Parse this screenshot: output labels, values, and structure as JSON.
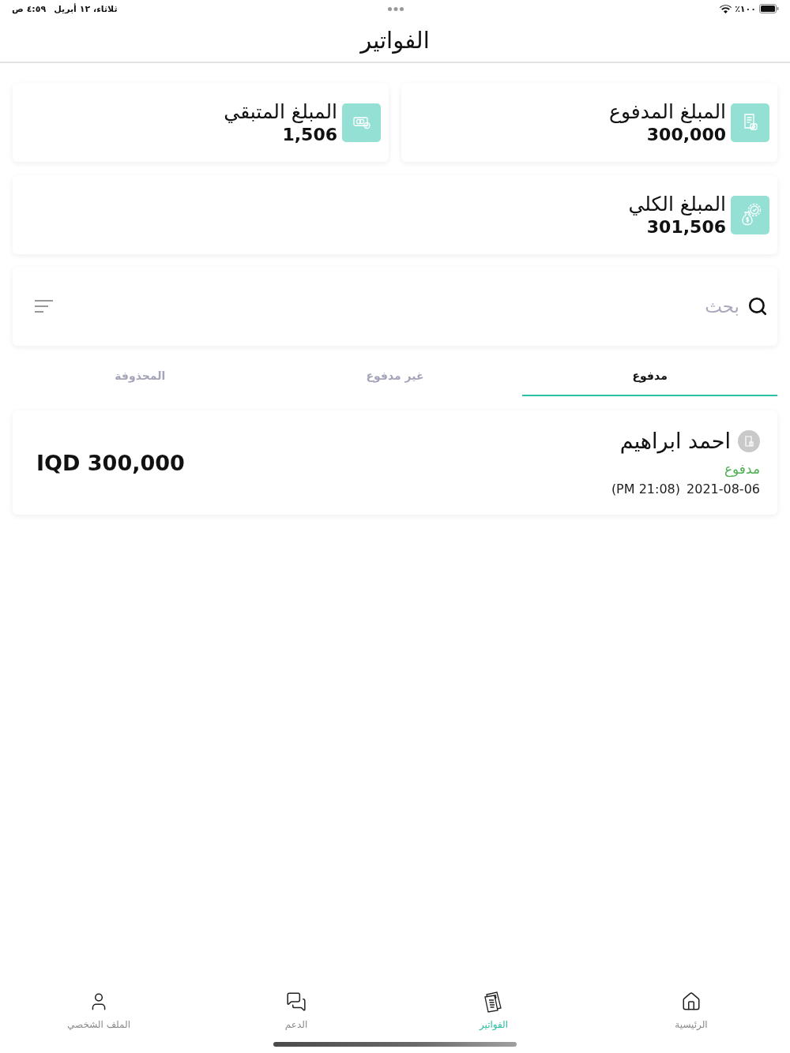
{
  "status_bar": {
    "time": "٤:٥٩ ص",
    "date": "ثلاثاء، ١٢ أبريل",
    "battery": "٪١٠٠"
  },
  "header": {
    "title": "الفواتير"
  },
  "summary_cards": [
    {
      "kind": "paid",
      "label": "المبلغ المدفوع",
      "value": "300,000"
    },
    {
      "kind": "remaining",
      "label": "المبلغ المتبقي",
      "value": "1,506"
    },
    {
      "kind": "total",
      "label": "المبلغ الكلي",
      "value": "301,506"
    }
  ],
  "search": {
    "placeholder": "بحث"
  },
  "tabs": [
    {
      "label": "مدفوع",
      "selected": true
    },
    {
      "label": "غير مدفوع",
      "selected": false
    },
    {
      "label": "المحذوفة",
      "selected": false
    }
  ],
  "invoices": [
    {
      "kind": "paid",
      "name": "احمد ابراهيم",
      "status": "مدفوع",
      "date": "2021-08-06",
      "time": "(PM 21:08)",
      "amount": "IQD 300,000"
    }
  ],
  "bottom_nav": [
    {
      "kind": "home",
      "label": "الرئيسية",
      "selected": false
    },
    {
      "kind": "invoices",
      "label": "الفواتير",
      "selected": true
    },
    {
      "kind": "support",
      "label": "الدعم",
      "selected": false
    },
    {
      "kind": "profile",
      "label": "الملف الشخصي",
      "selected": false
    }
  ]
}
